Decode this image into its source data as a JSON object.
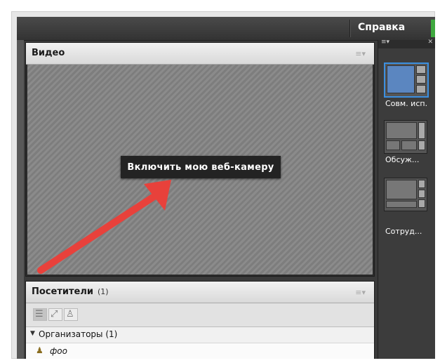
{
  "menu": {
    "help": "Справка"
  },
  "video_pod": {
    "title": "Видео",
    "menu_icon": "pod-menu-icon",
    "webcam_button": "Включить мою веб-камеру"
  },
  "attendees_pod": {
    "title": "Посетители",
    "count": "(1)",
    "group": {
      "label": "Организаторы (1)"
    },
    "attendee": {
      "name": "фоо"
    }
  },
  "layouts": [
    {
      "label": "Совм. исп.",
      "selected": true
    },
    {
      "label": "Обсуж...",
      "selected": false
    },
    {
      "label": "Сотруд...",
      "selected": false
    }
  ],
  "colors": {
    "accent": "#3b8fe0",
    "arrow": "#e8413b",
    "indicator": "#3ea83e"
  }
}
